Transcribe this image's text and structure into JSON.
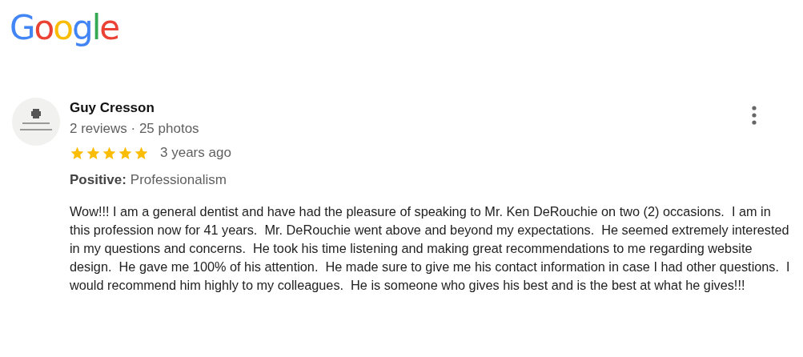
{
  "logo": "Google",
  "review": {
    "author": "Guy Cresson",
    "author_meta": "2 reviews · 25 photos",
    "stars": 5,
    "time": "3 years ago",
    "highlight_label": "Positive:",
    "highlight_value": "Professionalism",
    "text": "Wow!!! I am a general dentist and have had the pleasure of speaking to Mr. Ken DeRouchie on two (2) occasions.  I am in this profession now for 41 years.  Mr. DeRouchie went above and beyond my expectations.  He seemed extremely interested in my questions and concerns.  He took his time listening and making great recommendations to me regarding website design.  He gave me 100% of his attention.  He made sure to give me his contact information in case I had other questions.  I would recommend him highly to my colleagues.  He is someone who gives his best and is the best at what he gives!!!"
  }
}
